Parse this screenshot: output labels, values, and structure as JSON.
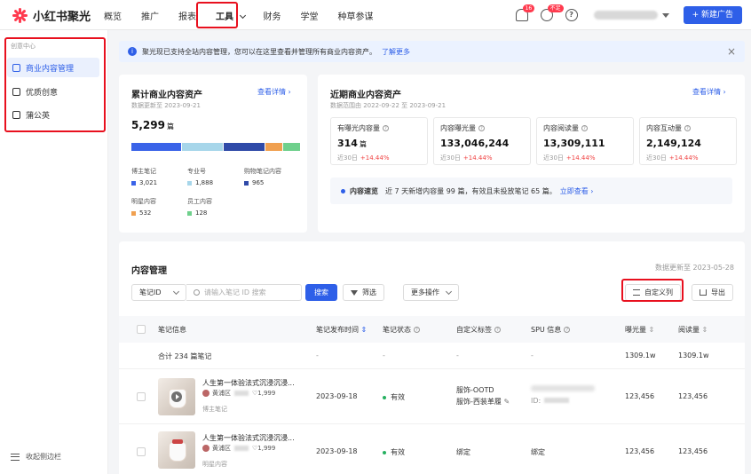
{
  "app": {
    "name": "小红书聚光",
    "brand_color": "#ff3a4e",
    "accent": "#2e5fe8",
    "highlight": "#e8101e"
  },
  "nav": {
    "items": [
      "概览",
      "推广",
      "报表"
    ],
    "active": "工具",
    "items_after": [
      "财务",
      "学堂",
      "种草参谋"
    ]
  },
  "topbar": {
    "bell_badge": "16",
    "wallet_badge": "不足",
    "new_ad_label": "+ 新建广告"
  },
  "sidebar": {
    "group": "创意中心",
    "items": [
      "商业内容管理",
      "优质创意",
      "蒲公英"
    ],
    "active": "商业内容管理",
    "collapse_label": "收起侧边栏"
  },
  "notice": {
    "text": "聚光现已支持全站内容管理，您可以在这里查看并管理所有商业内容资产。",
    "link": "了解更多"
  },
  "cumulative": {
    "title": "累计商业内容资产",
    "detail_link": "查看详情 ›",
    "updated": "数据更新至 2023-09-21",
    "total": "5,299",
    "unit": "篇",
    "segments": [
      {
        "name": "博主笔记",
        "value": "3,021",
        "color": "#3a63e8",
        "share": 0.29
      },
      {
        "name": "专业号",
        "value": "1,888",
        "color": "#a7d6ea",
        "share": 0.24
      },
      {
        "name": "购物笔记内容",
        "value": "965",
        "color": "#2f4aa8",
        "share": 0.24
      },
      {
        "name": "明星内容",
        "value": "532",
        "color": "#f0a050",
        "share": 0.1
      },
      {
        "name": "员工内容",
        "value": "128",
        "color": "#6fd08c",
        "share": 0.1
      }
    ]
  },
  "recent": {
    "title": "近期商业内容资产",
    "detail_link": "查看详情 ›",
    "range": "数据范围由 2022-09-22 至 2023-09-21",
    "metrics": [
      {
        "label": "有曝光内容量",
        "value": "314",
        "unit": "篇",
        "period": "近30日",
        "trend": "+14.44%"
      },
      {
        "label": "内容曝光量",
        "value": "133,046,244",
        "unit": "",
        "period": "近30日",
        "trend": "+14.44%"
      },
      {
        "label": "内容阅读量",
        "value": "13,309,111",
        "unit": "",
        "period": "近30日",
        "trend": "+14.44%"
      },
      {
        "label": "内容互动量",
        "value": "2,149,124",
        "unit": "",
        "period": "近30日",
        "trend": "+14.44%"
      }
    ],
    "quick": {
      "label": "内容速览",
      "text": "近 7 天新增内容量 99 篇，有效且未投放笔记 65 篇。",
      "link": "立即查看 ›"
    }
  },
  "management": {
    "title": "内容管理",
    "updated": "数据更新至 2023-05-28",
    "filter_select": "笔记ID",
    "search_placeholder": "请输入笔记 ID 搜索",
    "search_button": "搜索",
    "filter_button": "筛选",
    "more_ops": "更多操作",
    "custom_columns": "自定义列",
    "export": "导出",
    "columns": [
      "笔记信息",
      "笔记发布时间",
      "笔记状态",
      "自定义标签",
      "SPU 信息",
      "曝光量",
      "阅读量"
    ],
    "summary": {
      "label": "合计 234 篇笔记",
      "publish": "-",
      "status": "-",
      "tag": "-",
      "spu": "-",
      "impressions": "1309.1w",
      "reads": "1309.1w"
    },
    "rows": [
      {
        "title": "人生第一体验法式沉浸沉浸...",
        "author": "黄浦区",
        "likes": "1,999",
        "type": "博主笔记",
        "publish": "2023-09-18",
        "status": "有效",
        "tags": [
          "服饰-OOTD",
          "服饰-西装革履"
        ],
        "spu": "ID:",
        "impressions": "123,456",
        "reads": "123,456"
      },
      {
        "title": "人生第一体验法式沉浸沉浸...",
        "author": "黄浦区",
        "likes": "1,999",
        "type": "明星内容",
        "publish": "2023-09-18",
        "status": "有效",
        "tag_link": "绑定",
        "spu_link": "绑定",
        "impressions": "123,456",
        "reads": "123,456"
      }
    ]
  }
}
